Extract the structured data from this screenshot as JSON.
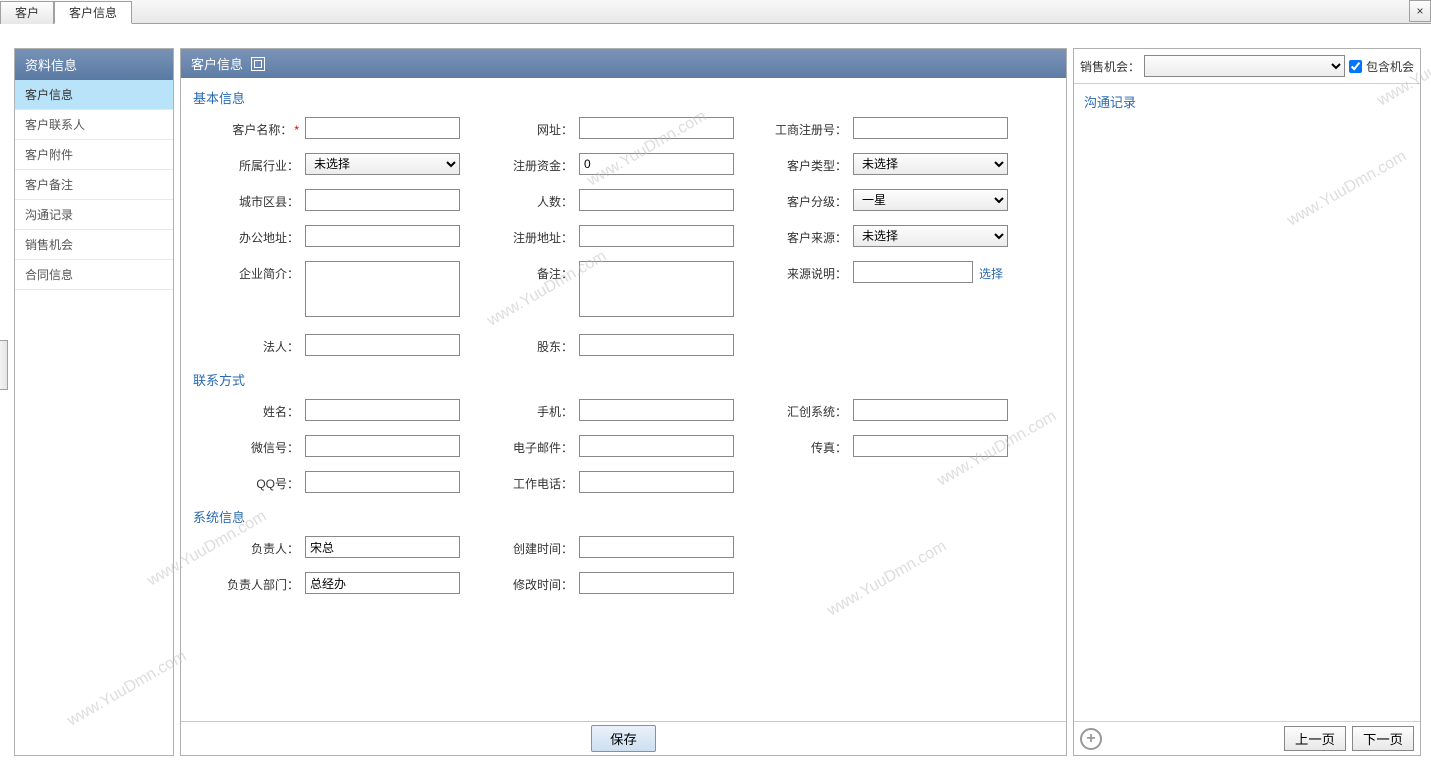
{
  "tabs": {
    "items": [
      "客户",
      "客户信息"
    ],
    "active_index": 1,
    "close_btn": "×"
  },
  "sidebar": {
    "title": "资料信息",
    "items": [
      "客户信息",
      "客户联系人",
      "客户附件",
      "客户备注",
      "沟通记录",
      "销售机会",
      "合同信息"
    ],
    "active_index": 0
  },
  "center": {
    "title": "客户信息",
    "sections": {
      "basic": {
        "title": "基本信息",
        "fields": {
          "name_label": "客户名称：",
          "name_value": "",
          "url_label": "网址：",
          "url_value": "",
          "regno_label": "工商注册号：",
          "regno_value": "",
          "industry_label": "所属行业：",
          "industry_value": "未选择",
          "regcap_label": "注册资金：",
          "regcap_value": "0",
          "ctype_label": "客户类型：",
          "ctype_value": "未选择",
          "city_label": "城市区县：",
          "city_value": "",
          "count_label": "人数：",
          "count_value": "",
          "grade_label": "客户分级：",
          "grade_value": "一星",
          "addr_label": "办公地址：",
          "addr_value": "",
          "regaddr_label": "注册地址：",
          "regaddr_value": "",
          "source_label": "客户来源：",
          "source_value": "未选择",
          "intro_label": "企业简介：",
          "intro_value": "",
          "remark_label": "备注：",
          "remark_value": "",
          "srcnote_label": "来源说明：",
          "srcnote_value": "",
          "srcnote_link": "选择",
          "legal_label": "法人：",
          "legal_value": "",
          "holder_label": "股东：",
          "holder_value": ""
        }
      },
      "contact": {
        "title": "联系方式",
        "fields": {
          "name_label": "姓名：",
          "name_value": "",
          "mobile_label": "手机：",
          "mobile_value": "",
          "sys_label": "汇创系统：",
          "sys_value": "",
          "wechat_label": "微信号：",
          "wechat_value": "",
          "email_label": "电子邮件：",
          "email_value": "",
          "fax_label": "传真：",
          "fax_value": "",
          "qq_label": "QQ号：",
          "qq_value": "",
          "tel_label": "工作电话：",
          "tel_value": ""
        }
      },
      "system": {
        "title": "系统信息",
        "fields": {
          "owner_label": "负责人：",
          "owner_value": "宋总",
          "ctime_label": "创建时间：",
          "ctime_value": "",
          "dept_label": "负责人部门：",
          "dept_value": "总经办",
          "mtime_label": "修改时间：",
          "mtime_value": ""
        }
      }
    },
    "save_btn": "保存"
  },
  "right": {
    "sale_label": "销售机会：",
    "sale_value": "",
    "include_label": "包含机会",
    "include_checked": true,
    "log_title": "沟通记录",
    "prev_btn": "上一页",
    "next_btn": "下一页"
  },
  "watermark": "www.YuuDmn.com"
}
